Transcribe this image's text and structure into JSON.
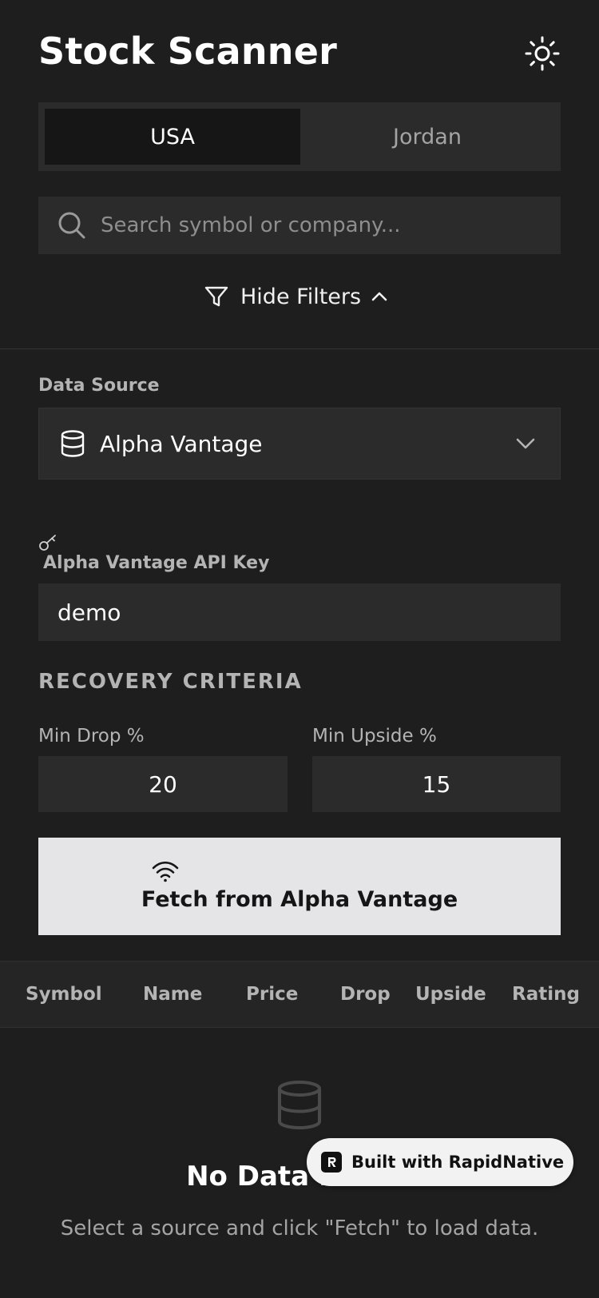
{
  "header": {
    "title": "Stock Scanner",
    "theme_icon": "sun-icon"
  },
  "market_tabs": [
    {
      "label": "USA",
      "active": true
    },
    {
      "label": "Jordan",
      "active": false
    }
  ],
  "search": {
    "placeholder": "Search symbol or company...",
    "value": "",
    "icon": "search-icon"
  },
  "filters": {
    "toggle_label": "Hide Filters",
    "icon": "filter-icon",
    "chevron": "chevron-up-icon"
  },
  "data_source": {
    "label": "Data Source",
    "selected": "Alpha Vantage",
    "icon": "database-icon"
  },
  "api_key": {
    "label": "Alpha Vantage API Key",
    "value": "demo",
    "icon": "key-icon"
  },
  "recovery": {
    "heading": "RECOVERY CRITERIA",
    "min_drop_label": "Min Drop %",
    "min_drop_value": "20",
    "min_upside_label": "Min Upside %",
    "min_upside_value": "15"
  },
  "fetch_button": {
    "label": "Fetch from Alpha Vantage",
    "icon": "wifi-icon"
  },
  "table": {
    "columns": [
      "Symbol",
      "Name",
      "Price",
      "Drop",
      "Upside",
      "Rating"
    ]
  },
  "empty_state": {
    "title": "No Data Found",
    "subtitle": "Select a source and click \"Fetch\" to load data.",
    "icon": "database-icon"
  },
  "badge": {
    "label": "Built with RapidNative"
  },
  "colors": {
    "background": "#1e1e1e",
    "surface": "#2b2b2b",
    "active_tab": "#161616",
    "button_bg": "#e5e5e7",
    "text_primary": "#ffffff",
    "text_muted": "#b4b4b4"
  }
}
